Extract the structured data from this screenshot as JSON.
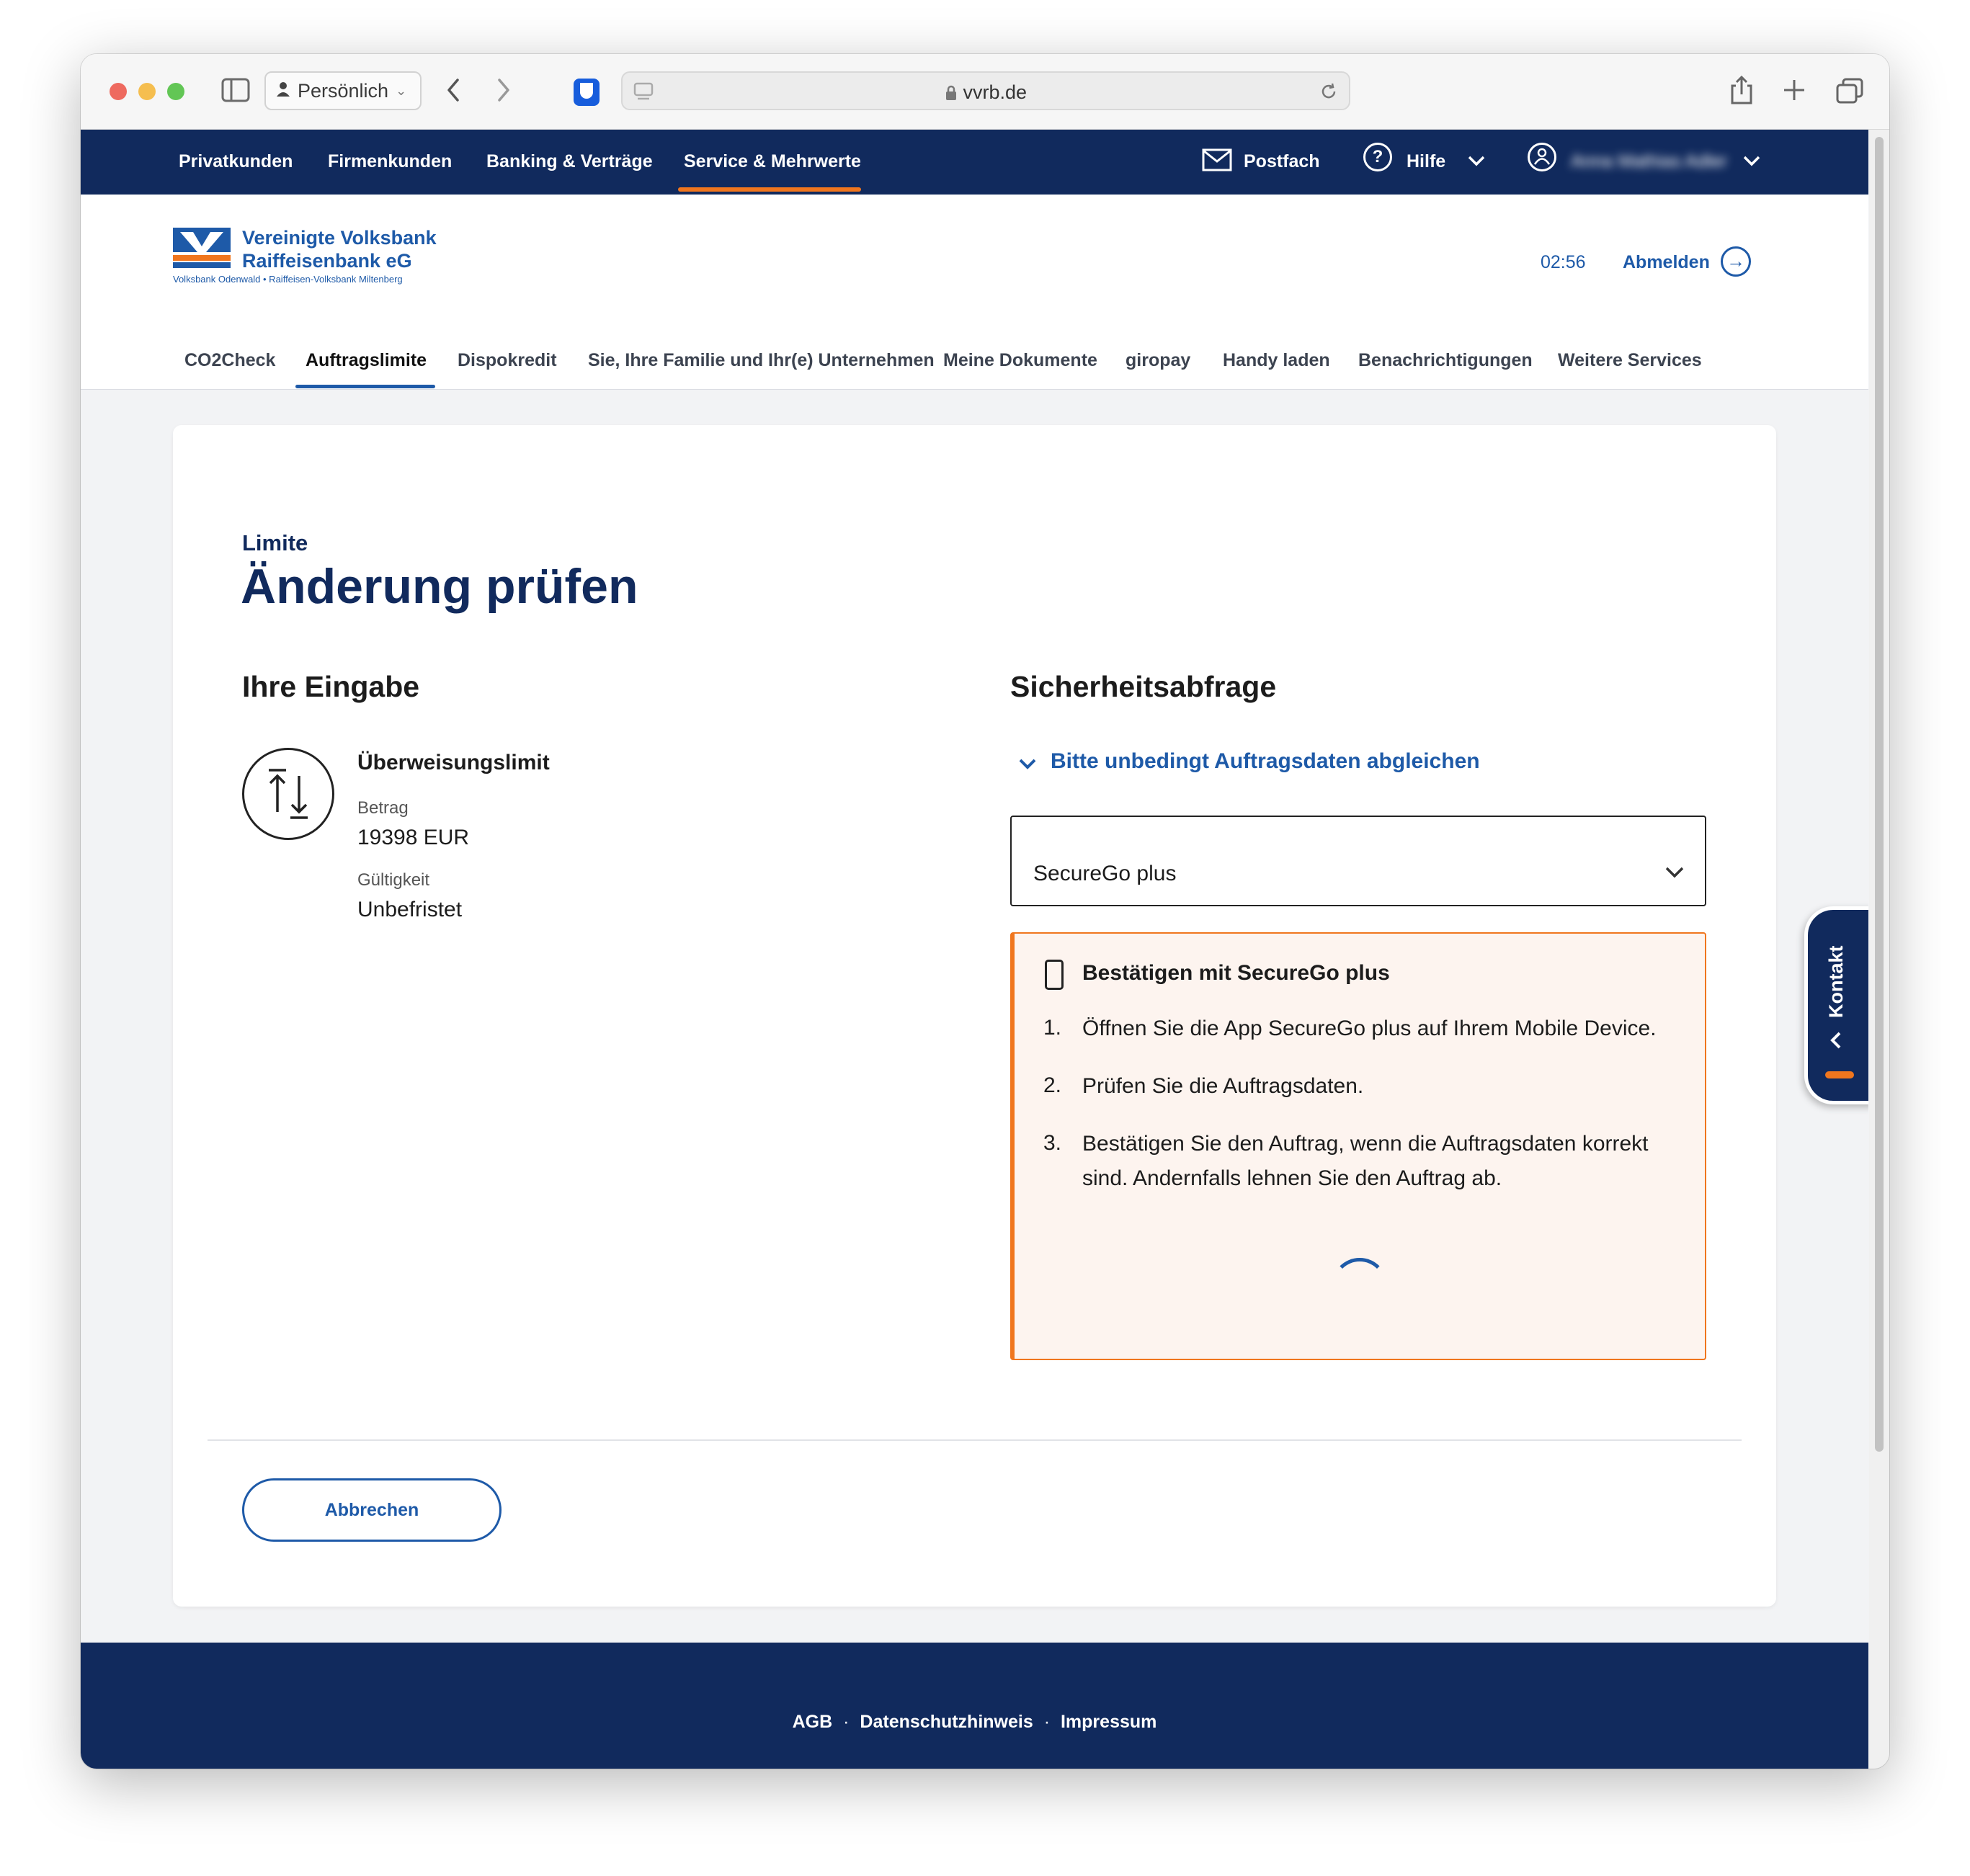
{
  "browser": {
    "profile_label": "Persönlich",
    "url": "vvrb.de"
  },
  "topnav": {
    "items": [
      "Privatkunden",
      "Firmenkunden",
      "Banking & Verträge",
      "Service & Mehrwerte"
    ],
    "active": "Service & Mehrwerte",
    "postfach": "Postfach",
    "hilfe": "Hilfe",
    "user_name": "Anna Mathias Adler"
  },
  "header": {
    "bank_name_line1": "Vereinigte Volksbank",
    "bank_name_line2": "Raiffeisenbank eG",
    "bank_subtitle": "Volksbank Odenwald • Raiffeisen-Volksbank Miltenberg",
    "session_timer": "02:56",
    "logout_label": "Abmelden"
  },
  "subnav": {
    "items": [
      "CO2Check",
      "Auftragslimite",
      "Dispokredit",
      "Sie, Ihre Familie und Ihr(e) Unternehmen",
      "Meine Dokumente",
      "giropay",
      "Handy laden",
      "Benachrichtigungen",
      "Weitere Services"
    ],
    "active": "Auftragslimite"
  },
  "main": {
    "kicker": "Limite",
    "title": "Änderung prüfen",
    "input_section": {
      "heading": "Ihre Eingabe",
      "item_title": "Überweisungslimit",
      "amount_label": "Betrag",
      "amount_value": "19398 EUR",
      "validity_label": "Gültigkeit",
      "validity_value": "Unbefristet"
    },
    "security_section": {
      "heading": "Sicherheitsabfrage",
      "disclosure_label": "Bitte unbedingt Auftragsdaten abgleichen",
      "method_selected": "SecureGo plus",
      "notice_title": "Bestätigen mit SecureGo plus",
      "steps": [
        {
          "num": "1.",
          "text": "Öffnen Sie die App SecureGo plus auf Ihrem Mobile Device."
        },
        {
          "num": "2.",
          "text": "Prüfen Sie die Auftragsdaten."
        },
        {
          "num": "3.",
          "text": "Bestätigen Sie den Auftrag, wenn die Auftragsdaten korrekt sind. Andernfalls lehnen Sie den Auftrag ab."
        }
      ]
    },
    "cancel_label": "Abbrechen"
  },
  "footer": {
    "links": [
      "AGB",
      "Datenschutzhinweis",
      "Impressum"
    ],
    "separator": "·"
  },
  "kontakt_label": "Kontakt",
  "colors": {
    "navy": "#112a5d",
    "brand_blue": "#1e5aa8",
    "accent_orange": "#f0761e",
    "notice_bg": "#fdf4ef"
  }
}
